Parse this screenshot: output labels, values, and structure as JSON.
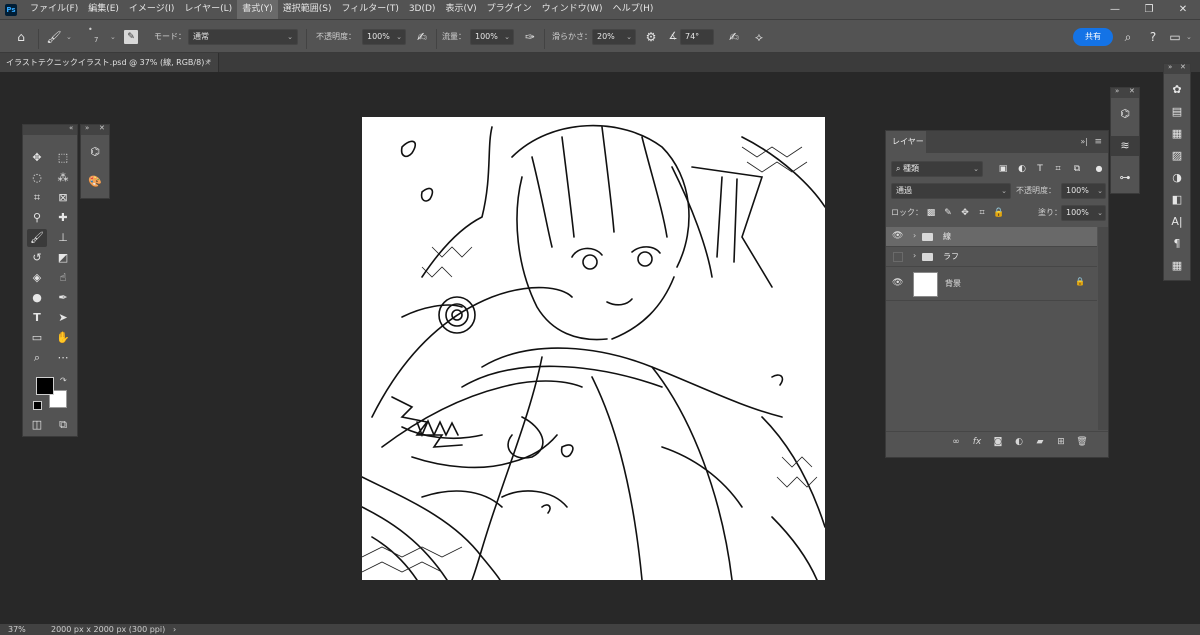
{
  "menubar": {
    "logo": "Ps",
    "items": [
      "ファイル(F)",
      "編集(E)",
      "イメージ(I)",
      "レイヤー(L)",
      "書式(Y)",
      "選択範囲(S)",
      "フィルター(T)",
      "3D(D)",
      "表示(V)",
      "プラグイン",
      "ウィンドウ(W)",
      "ヘルプ(H)"
    ],
    "active_item": "書式(Y)"
  },
  "window_controls": {
    "minimize": "—",
    "restore": "❐",
    "close": "✕"
  },
  "options": {
    "brush_size": "7",
    "mode_label": "モード：",
    "mode_value": "通常",
    "opacity_label": "不透明度：",
    "opacity_value": "100%",
    "flow_label": "流量：",
    "flow_value": "100%",
    "smoothing_label": "滑らかさ：",
    "smoothing_value": "20%",
    "angle_value": "74°",
    "share_label": "共有"
  },
  "document": {
    "tab_title": "イラストテクニックイラスト.psd @ 37% (線, RGB/8) *",
    "close": "×"
  },
  "layers_panel": {
    "tab_label": "レイヤー",
    "filter_value": "種類",
    "blend_mode": "通過",
    "opacity_label": "不透明度：",
    "opacity_value": "100%",
    "lock_label": "ロック：",
    "fill_label": "塗り：",
    "fill_value": "100%",
    "layers": [
      {
        "name": "線",
        "type": "group",
        "visible": true,
        "selected": true
      },
      {
        "name": "ラフ",
        "type": "group",
        "visible": false,
        "selected": false
      },
      {
        "name": "背景",
        "type": "pixel",
        "visible": true,
        "selected": false,
        "locked": true
      }
    ]
  },
  "status": {
    "zoom": "37%",
    "doc_info": "2000 px x 2000 px (300 ppi)"
  }
}
